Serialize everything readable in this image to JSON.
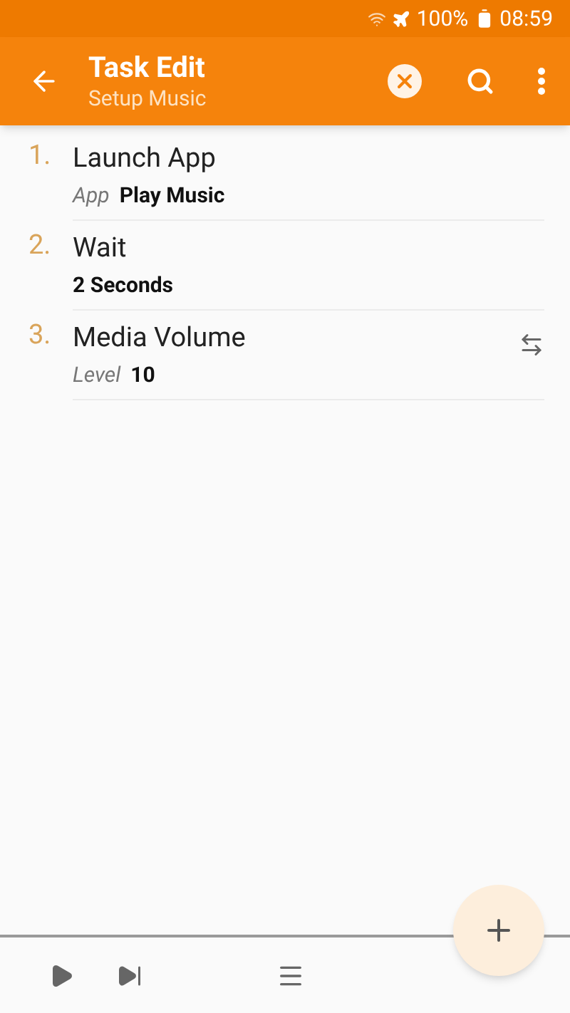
{
  "status_bar": {
    "battery": "100%",
    "time": "08:59"
  },
  "app_bar": {
    "title": "Task Edit",
    "subtitle": "Setup Music"
  },
  "actions": [
    {
      "number": "1.",
      "name": "Launch App",
      "swap_icon": false,
      "params": [
        {
          "label": "App",
          "value": "Play Music"
        }
      ]
    },
    {
      "number": "2.",
      "name": "Wait",
      "swap_icon": false,
      "params": [
        {
          "value": "2 Seconds"
        }
      ]
    },
    {
      "number": "3.",
      "name": "Media Volume",
      "swap_icon": true,
      "params": [
        {
          "label": "Level",
          "value": "10"
        }
      ]
    }
  ]
}
